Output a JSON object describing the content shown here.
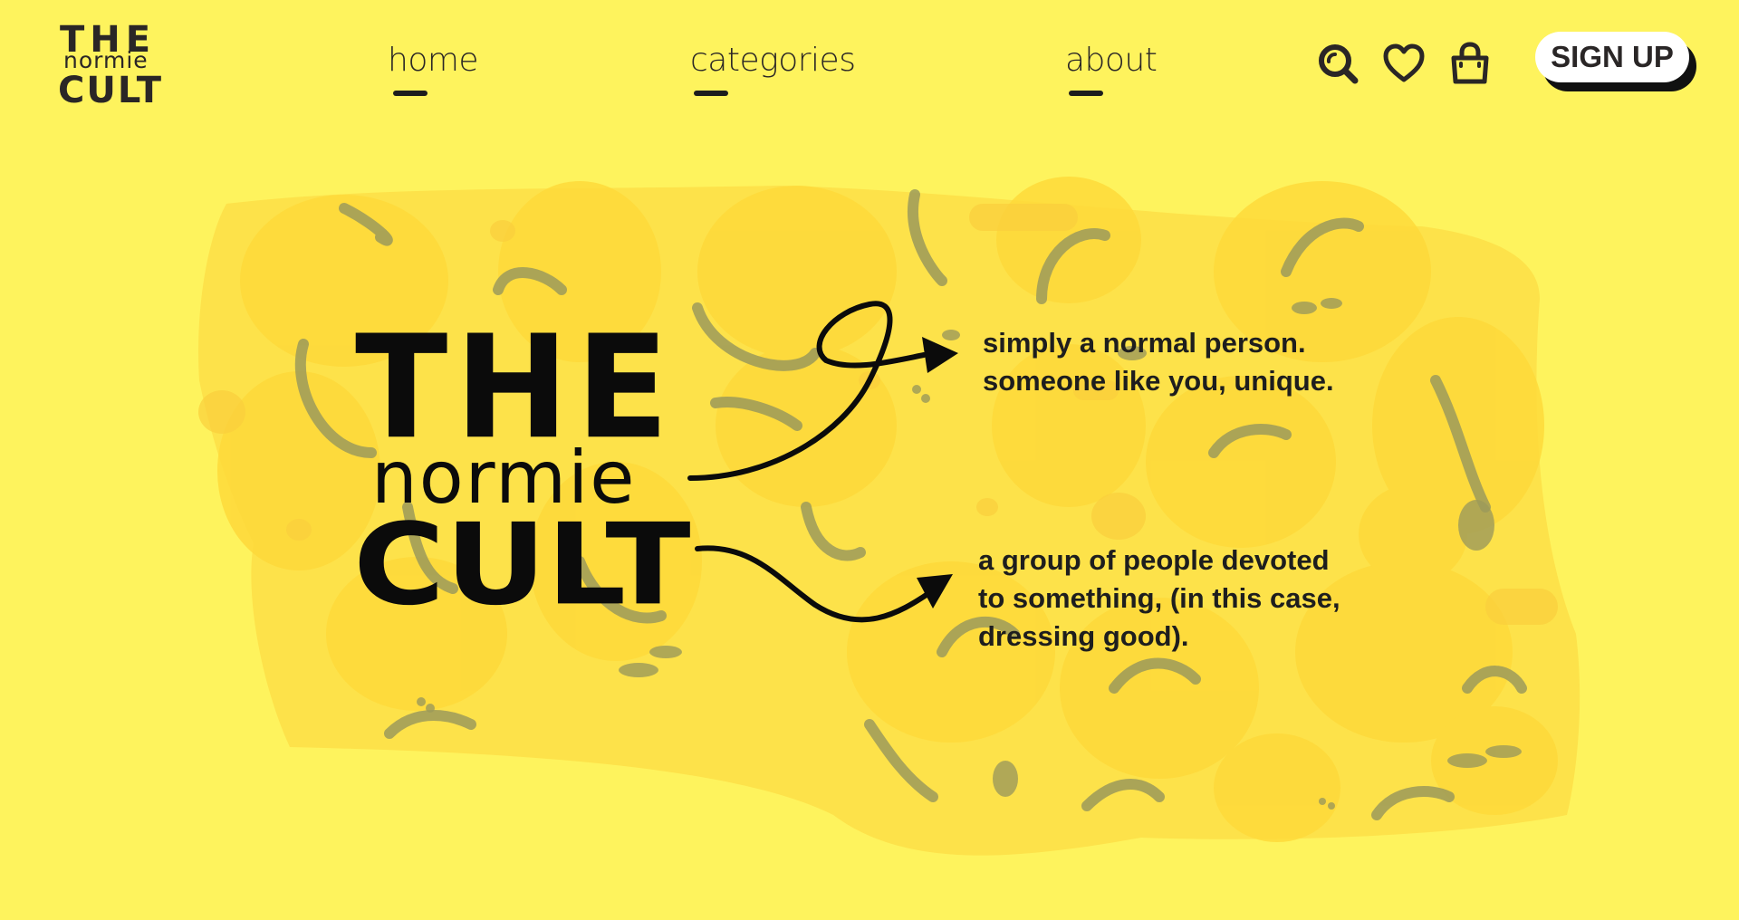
{
  "header": {
    "logo": {
      "the": "THE",
      "normie": "normie",
      "cult": "CULT"
    },
    "nav": [
      {
        "label": "home"
      },
      {
        "label": "categories"
      },
      {
        "label": "about"
      }
    ],
    "icons": [
      "search-icon",
      "heart-icon",
      "shopping-bag-icon"
    ],
    "signup_label": "SIGN UP"
  },
  "hero": {
    "title_the": "THE",
    "title_normie": "normie",
    "title_cult": "CULT",
    "definition_normie": [
      "simply a normal person.",
      "someone like you, unique."
    ],
    "definition_cult": [
      "a group of people devoted",
      "to something, (in this case,",
      "dressing good)."
    ]
  },
  "colors": {
    "background": "#fef35d",
    "pattern_blob": "#fde23a",
    "pattern_face": "#9c9a5a",
    "ink": "#0b0b0b",
    "button_bg": "#ffffff"
  }
}
